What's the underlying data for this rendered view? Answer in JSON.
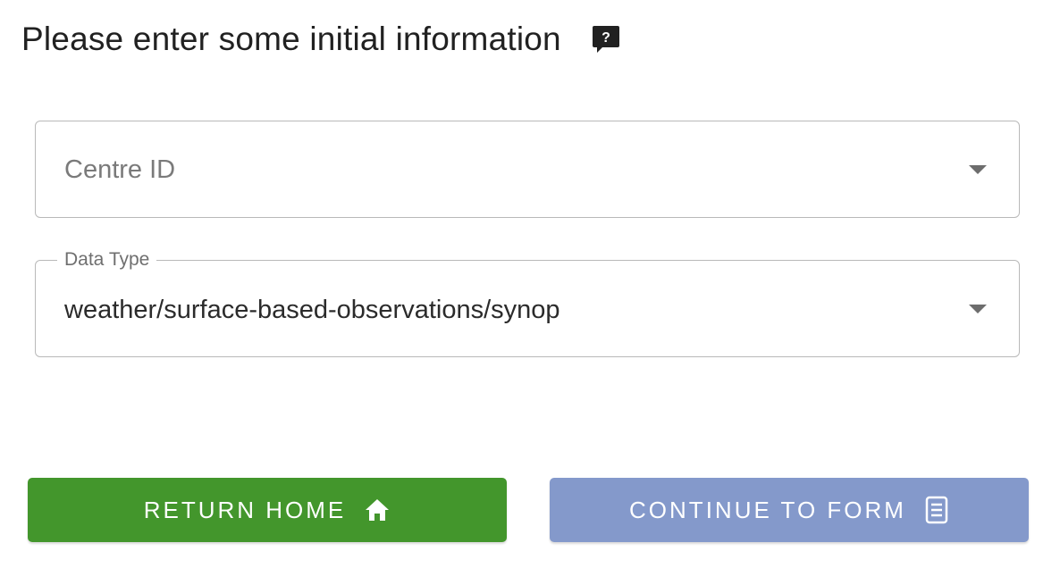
{
  "header": {
    "title": "Please enter some initial information",
    "help_icon": "help-chat-icon"
  },
  "form": {
    "centre_id": {
      "placeholder": "Centre ID",
      "value": ""
    },
    "data_type": {
      "label": "Data Type",
      "value": "weather/surface-based-observations/synop"
    }
  },
  "actions": {
    "return_home": {
      "label": "RETURN HOME",
      "icon": "home-icon",
      "color": "#43962c"
    },
    "continue": {
      "label": "CONTINUE TO FORM",
      "icon": "form-icon",
      "color": "#8499cb"
    }
  }
}
